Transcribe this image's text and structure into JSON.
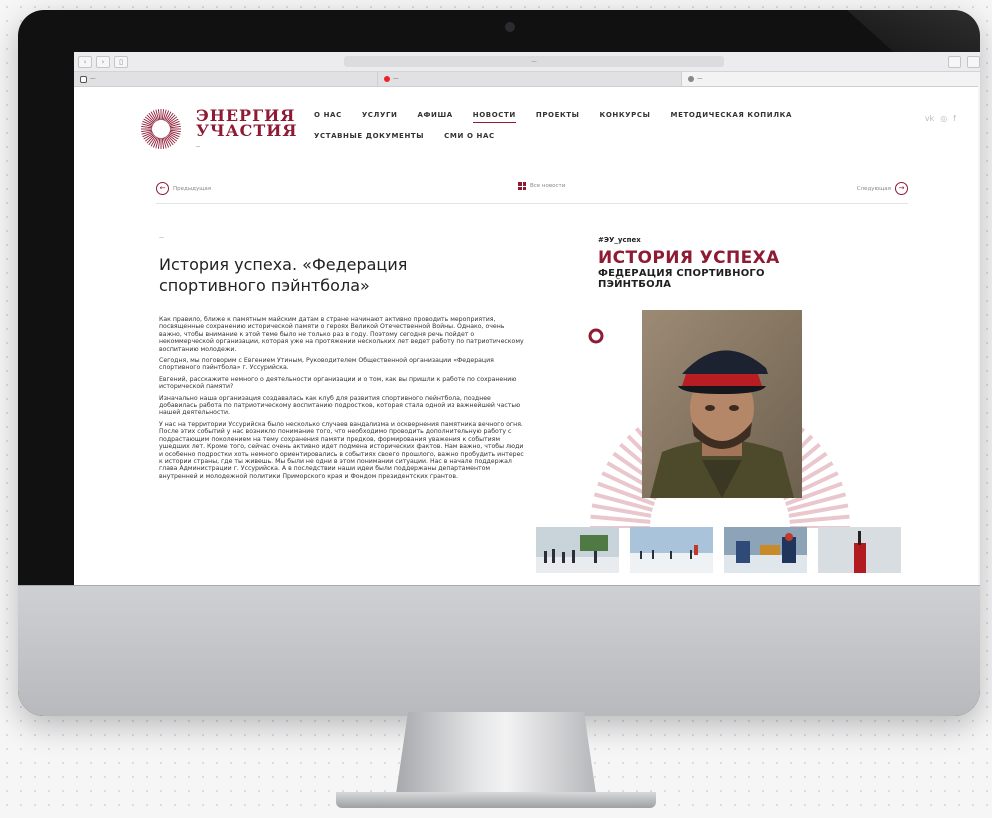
{
  "browser": {
    "url": "—",
    "tabs": [
      {
        "label": "—",
        "icon": "instagram-icon"
      },
      {
        "label": "—",
        "icon": "youtube-icon"
      },
      {
        "label": "—",
        "icon": "globe-icon"
      }
    ]
  },
  "site": {
    "logo_line1": "ЭНЕРГИЯ",
    "logo_line2": "УЧАСТИЯ",
    "logo_sub": "—",
    "nav_row1": [
      "О НАС",
      "УСЛУГИ",
      "АФИША",
      "НОВОСТИ",
      "ПРОЕКТЫ",
      "КОНКУРСЫ",
      "МЕТОДИЧЕСКАЯ КОПИЛКА"
    ],
    "nav_row2": [
      "УСТАВНЫЕ ДОКУМЕНТЫ",
      "СМИ О НАС"
    ],
    "nav_active": "НОВОСТИ",
    "social": [
      "vk-icon",
      "instagram-icon",
      "facebook-icon"
    ]
  },
  "pager": {
    "prev": "Предыдущая",
    "all": "Все новости",
    "next": "Следующая"
  },
  "article": {
    "date": "—",
    "title": "История успеха. «Федерация спортивного пэйнтбола»",
    "paragraphs": [
      "Как правило, ближе к памятным майским датам в стране начинают активно проводить мероприятия, посвященные сохранению исторической памяти о героях Великой Отечественной Войны. Однако, очень важно, чтобы внимание к этой теме было не только раз в году. Поэтому сегодня речь пойдет о некоммерческой организации, которая уже на протяжении нескольких лет ведет работу по патриотическому воспитанию молодежи.",
      "Сегодня, мы поговорим с Евгением Утиным, Руководителем Общественной организации «Федерация спортивного пэйнтбола» г. Уссурийска.",
      "Евгений, расскажите немного о деятельности организации и о том, как вы пришли к работе по сохранению исторической памяти?",
      "Изначально наша организация создавалась как клуб для развития спортивного пейнтбола, позднее добавилась работа по патриотическому воспитанию подростков, которая стала одной из важнейшей частью нашей деятельности.",
      "У нас на территории Уссурийска было несколько случаев вандализма и осквернения памятника вечного огня. После этих событий у нас возникло понимание того, что необходимо проводить дополнительную работу с подрастающим поколением на тему сохранения памяти предков, формирования уважения к событиям ушедших лет. Кроме того, сейчас очень активно идет подмена исторических фактов. Нам важно, чтобы люди и особенно подростки хоть немного ориентировались в событиях своего прошлого, важно пробудить интерес к истории страны, где ты живешь. Мы были не одни в этом понимании ситуации. Нас в начале поддержал глава Администрации г. Уссурийска. А в последствии наши идеи были поддержаны департаментом внутренней и молодежной политики Приморского края и Фондом президентских грантов."
    ]
  },
  "card": {
    "tag": "#ЭУ_успех",
    "heading": "ИСТОРИЯ УСПЕХА",
    "subheading": "ФЕДЕРАЦИЯ СПОРТИВНОГО ПЭЙНТБОЛА"
  },
  "colors": {
    "brand": "#8e1a34",
    "arc": "#e9c7cd"
  }
}
